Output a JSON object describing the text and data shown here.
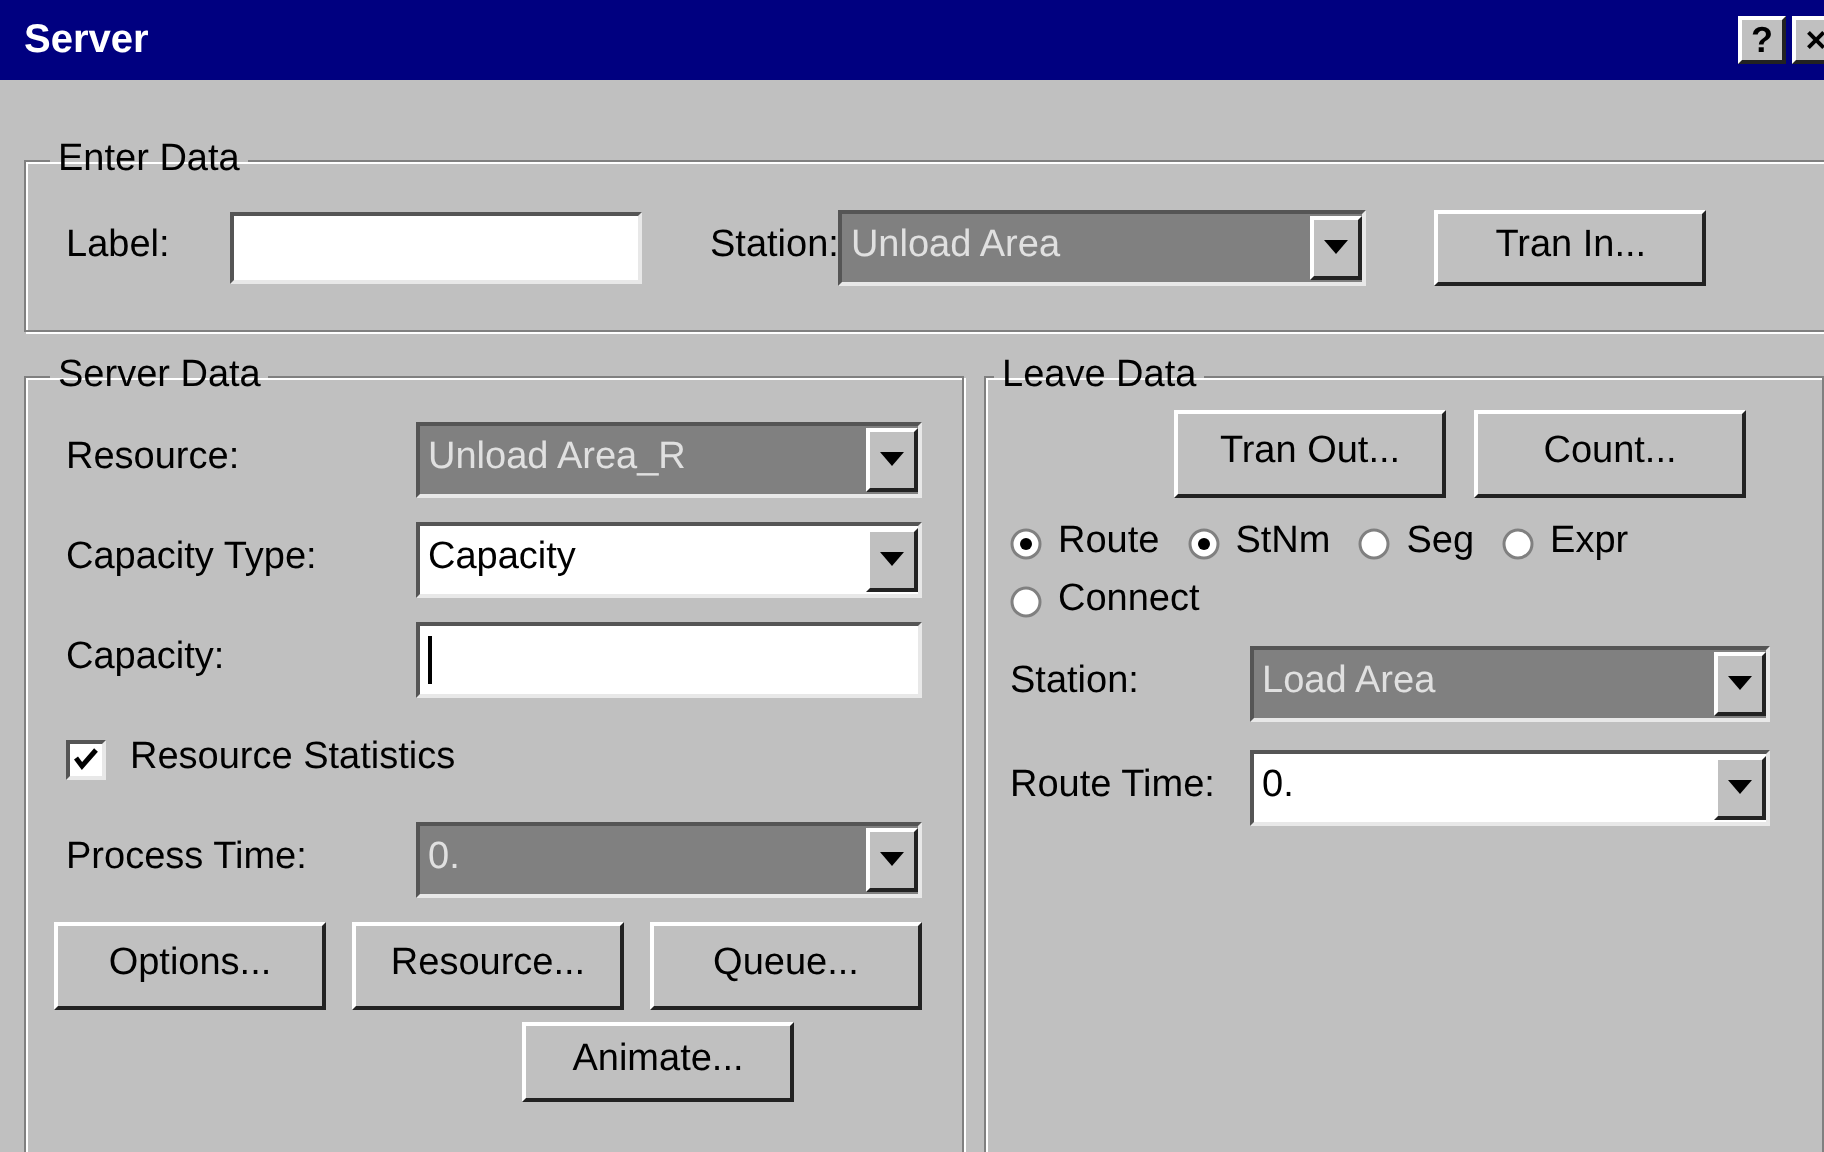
{
  "window": {
    "title": "Server",
    "buttons": [
      "?",
      "×"
    ]
  },
  "enter_data": {
    "title": "Enter Data",
    "label_field": {
      "label": "Label:"
    },
    "station": {
      "label": "Station:",
      "value": "Unload Area",
      "highlighted": true
    },
    "button": {
      "label": "Tran In..."
    }
  },
  "server_data": {
    "title": "Server Data",
    "fields": [
      {
        "kind": "dropdown",
        "label": "Resource:",
        "value": "Unload Area_R",
        "highlighted": true
      },
      {
        "kind": "dropdown",
        "label": "Capacity Type:",
        "value": "Capacity",
        "highlighted": false
      },
      {
        "kind": "text",
        "label": "Capacity:",
        "focused": true
      },
      {
        "kind": "checkbox",
        "label": "Resource Statistics",
        "checked": true
      },
      {
        "kind": "dropdown",
        "label": "Process Time:",
        "value": "0.",
        "highlighted": true
      }
    ],
    "buttons": [
      {
        "label": "Options..."
      },
      {
        "label": "Resource..."
      },
      {
        "label": "Queue..."
      },
      {
        "label": "Animate..."
      }
    ]
  },
  "leave_data": {
    "title": "Leave Data",
    "buttons": [
      {
        "label": "Tran Out..."
      },
      {
        "label": "Count..."
      }
    ],
    "radios": [
      {
        "label": "Route",
        "selected": true
      },
      {
        "label": "StNm",
        "selected": true
      },
      {
        "label": "Seg",
        "selected": false
      },
      {
        "label": "Expr",
        "selected": false
      },
      {
        "label": "Connect",
        "selected": false
      }
    ],
    "fields": [
      {
        "label": "Station:",
        "value": "Load Area",
        "highlighted": true
      },
      {
        "label": "Route Time:",
        "value": "0.",
        "highlighted": false
      }
    ]
  }
}
